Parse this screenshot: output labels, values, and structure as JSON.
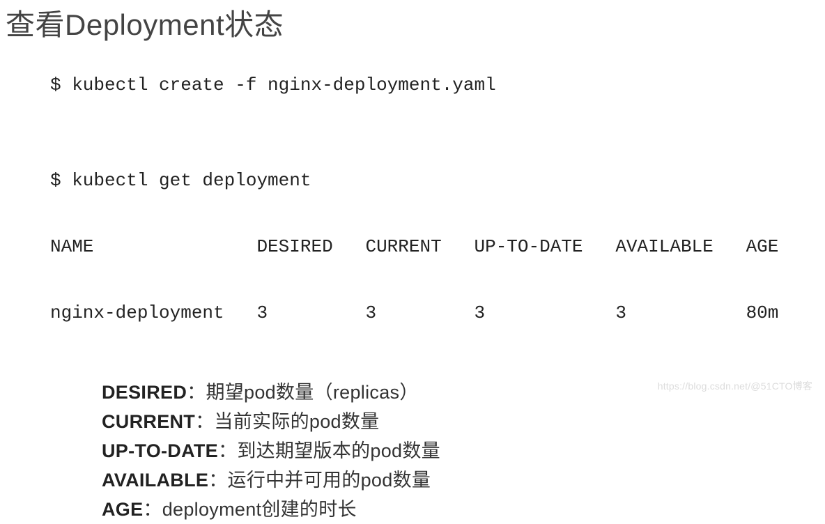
{
  "title": "查看Deployment状态",
  "commands": {
    "create": "$ kubectl create -f nginx-deployment.yaml",
    "get": "$ kubectl get deployment",
    "table_header": "NAME               DESIRED   CURRENT   UP-TO-DATE   AVAILABLE   AGE",
    "table_row": "nginx-deployment   3         3         3            3           80m"
  },
  "definitions": [
    {
      "label": "DESIRED",
      "sep": "：",
      "desc": "期望pod数量（replicas）"
    },
    {
      "label": "CURRENT",
      "sep": "：",
      "desc": "当前实际的pod数量"
    },
    {
      "label": "UP-TO-DATE",
      "sep": "：",
      "desc": "到达期望版本的pod数量"
    },
    {
      "label": "AVAILABLE",
      "sep": "：",
      "desc": "运行中并可用的pod数量"
    },
    {
      "label": "AGE",
      "sep": "：",
      "desc": "deployment创建的时长"
    }
  ],
  "watermark": "https://blog.csdn.net/@51CTO博客"
}
